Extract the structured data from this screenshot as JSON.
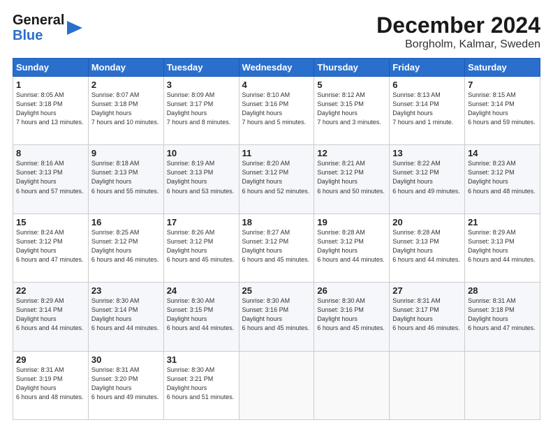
{
  "header": {
    "logo_line1": "General",
    "logo_line2": "Blue",
    "title": "December 2024",
    "subtitle": "Borgholm, Kalmar, Sweden"
  },
  "weekdays": [
    "Sunday",
    "Monday",
    "Tuesday",
    "Wednesday",
    "Thursday",
    "Friday",
    "Saturday"
  ],
  "weeks": [
    [
      {
        "day": "1",
        "sunrise": "8:05 AM",
        "sunset": "3:18 PM",
        "daylight": "7 hours and 13 minutes."
      },
      {
        "day": "2",
        "sunrise": "8:07 AM",
        "sunset": "3:18 PM",
        "daylight": "7 hours and 10 minutes."
      },
      {
        "day": "3",
        "sunrise": "8:09 AM",
        "sunset": "3:17 PM",
        "daylight": "7 hours and 8 minutes."
      },
      {
        "day": "4",
        "sunrise": "8:10 AM",
        "sunset": "3:16 PM",
        "daylight": "7 hours and 5 minutes."
      },
      {
        "day": "5",
        "sunrise": "8:12 AM",
        "sunset": "3:15 PM",
        "daylight": "7 hours and 3 minutes."
      },
      {
        "day": "6",
        "sunrise": "8:13 AM",
        "sunset": "3:14 PM",
        "daylight": "7 hours and 1 minute."
      },
      {
        "day": "7",
        "sunrise": "8:15 AM",
        "sunset": "3:14 PM",
        "daylight": "6 hours and 59 minutes."
      }
    ],
    [
      {
        "day": "8",
        "sunrise": "8:16 AM",
        "sunset": "3:13 PM",
        "daylight": "6 hours and 57 minutes."
      },
      {
        "day": "9",
        "sunrise": "8:18 AM",
        "sunset": "3:13 PM",
        "daylight": "6 hours and 55 minutes."
      },
      {
        "day": "10",
        "sunrise": "8:19 AM",
        "sunset": "3:13 PM",
        "daylight": "6 hours and 53 minutes."
      },
      {
        "day": "11",
        "sunrise": "8:20 AM",
        "sunset": "3:12 PM",
        "daylight": "6 hours and 52 minutes."
      },
      {
        "day": "12",
        "sunrise": "8:21 AM",
        "sunset": "3:12 PM",
        "daylight": "6 hours and 50 minutes."
      },
      {
        "day": "13",
        "sunrise": "8:22 AM",
        "sunset": "3:12 PM",
        "daylight": "6 hours and 49 minutes."
      },
      {
        "day": "14",
        "sunrise": "8:23 AM",
        "sunset": "3:12 PM",
        "daylight": "6 hours and 48 minutes."
      }
    ],
    [
      {
        "day": "15",
        "sunrise": "8:24 AM",
        "sunset": "3:12 PM",
        "daylight": "6 hours and 47 minutes."
      },
      {
        "day": "16",
        "sunrise": "8:25 AM",
        "sunset": "3:12 PM",
        "daylight": "6 hours and 46 minutes."
      },
      {
        "day": "17",
        "sunrise": "8:26 AM",
        "sunset": "3:12 PM",
        "daylight": "6 hours and 45 minutes."
      },
      {
        "day": "18",
        "sunrise": "8:27 AM",
        "sunset": "3:12 PM",
        "daylight": "6 hours and 45 minutes."
      },
      {
        "day": "19",
        "sunrise": "8:28 AM",
        "sunset": "3:12 PM",
        "daylight": "6 hours and 44 minutes."
      },
      {
        "day": "20",
        "sunrise": "8:28 AM",
        "sunset": "3:13 PM",
        "daylight": "6 hours and 44 minutes."
      },
      {
        "day": "21",
        "sunrise": "8:29 AM",
        "sunset": "3:13 PM",
        "daylight": "6 hours and 44 minutes."
      }
    ],
    [
      {
        "day": "22",
        "sunrise": "8:29 AM",
        "sunset": "3:14 PM",
        "daylight": "6 hours and 44 minutes."
      },
      {
        "day": "23",
        "sunrise": "8:30 AM",
        "sunset": "3:14 PM",
        "daylight": "6 hours and 44 minutes."
      },
      {
        "day": "24",
        "sunrise": "8:30 AM",
        "sunset": "3:15 PM",
        "daylight": "6 hours and 44 minutes."
      },
      {
        "day": "25",
        "sunrise": "8:30 AM",
        "sunset": "3:16 PM",
        "daylight": "6 hours and 45 minutes."
      },
      {
        "day": "26",
        "sunrise": "8:30 AM",
        "sunset": "3:16 PM",
        "daylight": "6 hours and 45 minutes."
      },
      {
        "day": "27",
        "sunrise": "8:31 AM",
        "sunset": "3:17 PM",
        "daylight": "6 hours and 46 minutes."
      },
      {
        "day": "28",
        "sunrise": "8:31 AM",
        "sunset": "3:18 PM",
        "daylight": "6 hours and 47 minutes."
      }
    ],
    [
      {
        "day": "29",
        "sunrise": "8:31 AM",
        "sunset": "3:19 PM",
        "daylight": "6 hours and 48 minutes."
      },
      {
        "day": "30",
        "sunrise": "8:31 AM",
        "sunset": "3:20 PM",
        "daylight": "6 hours and 49 minutes."
      },
      {
        "day": "31",
        "sunrise": "8:30 AM",
        "sunset": "3:21 PM",
        "daylight": "6 hours and 51 minutes."
      },
      null,
      null,
      null,
      null
    ]
  ]
}
